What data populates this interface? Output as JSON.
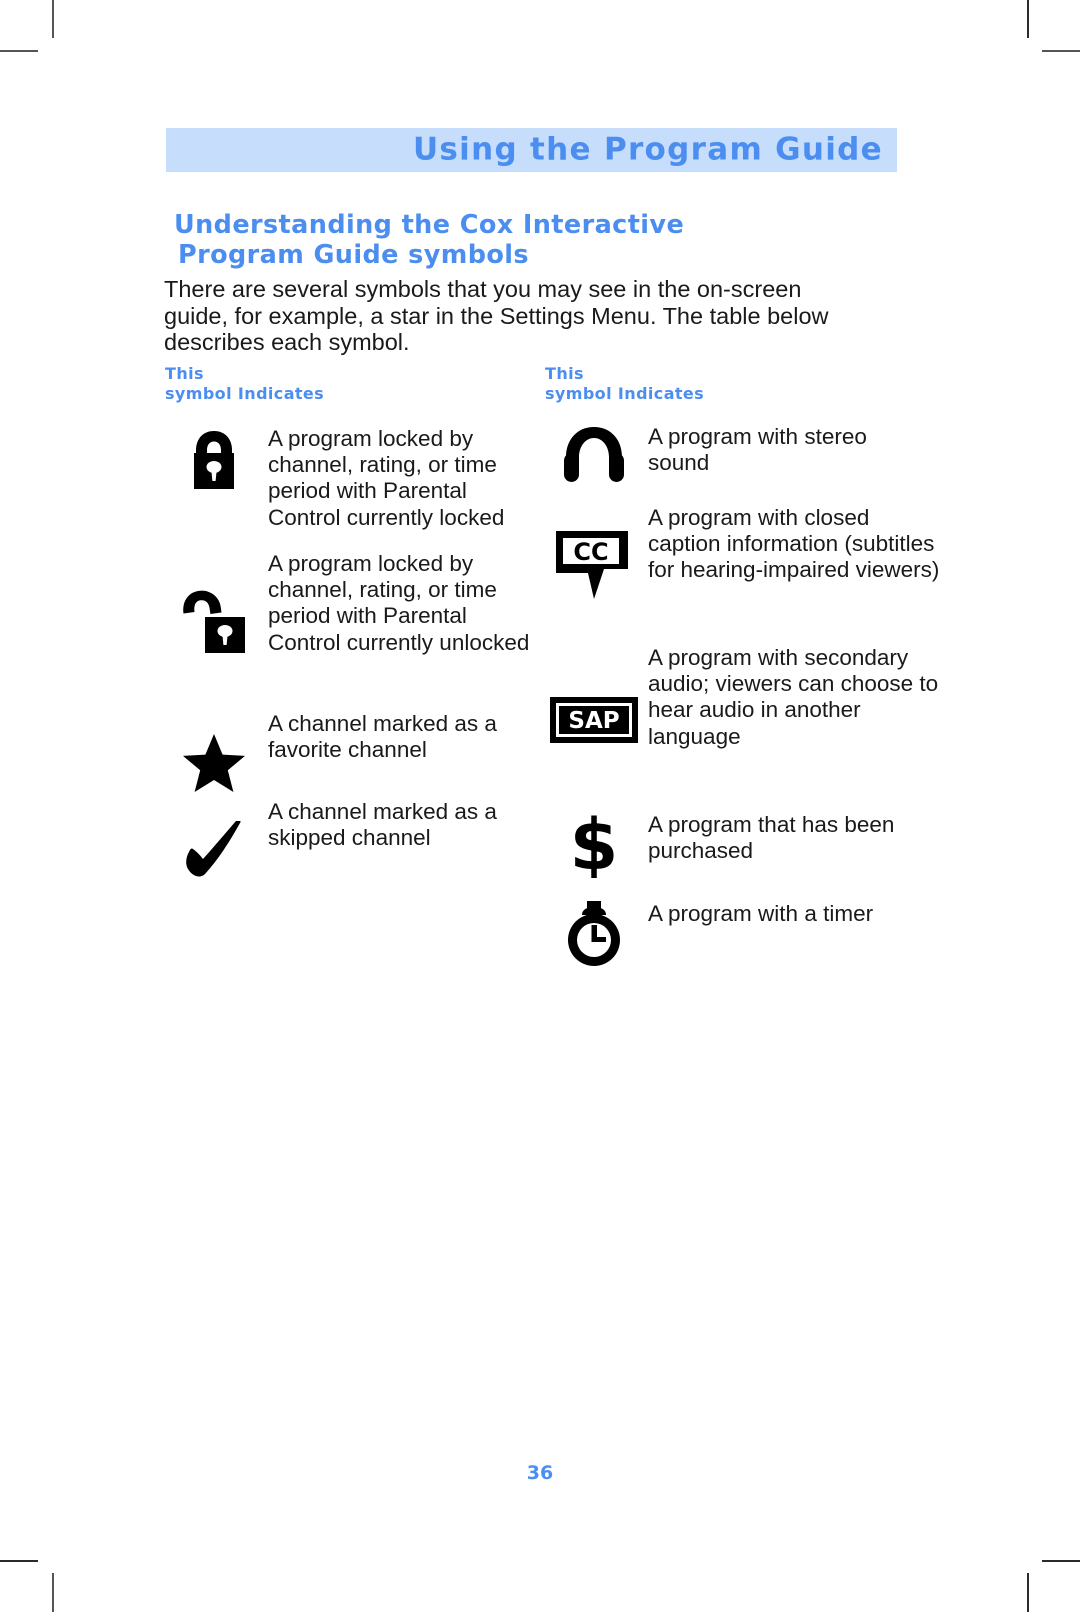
{
  "document": {
    "running_header": "Using the Program Guide",
    "section_heading_line1": "Understanding the Cox Interactive",
    "section_heading_line2": "Program Guide symbols",
    "intro_paragraph": "There are several symbols that you may see in the on-screen guide, for example, a star in the Settings Menu. The table below describes each symbol.",
    "page_number": "36"
  },
  "colors": {
    "accent_blue": "#4c8ef0",
    "banner_background": "#c6ddfb",
    "body_text": "#1a1a1a",
    "symbol_black": "#000000"
  },
  "table": {
    "headers": {
      "left": {
        "line1": "This",
        "line2": "symbol Indicates"
      },
      "right": {
        "line1": "This",
        "line2": "symbol Indicates"
      }
    },
    "left_column": [
      {
        "icon": "padlock-closed-icon",
        "description": "A program locked by channel, rating, or time period with Parental Control currently locked"
      },
      {
        "icon": "padlock-open-icon",
        "description": "A program locked by channel, rating, or time period with Parental Control currently unlocked"
      },
      {
        "icon": "star-icon",
        "description": "A channel marked as a favorite channel"
      },
      {
        "icon": "checkmark-icon",
        "description": "A channel marked as a skipped channel"
      }
    ],
    "right_column": [
      {
        "icon": "headphones-icon",
        "description": "A program with stereo sound"
      },
      {
        "icon": "closed-caption-icon",
        "icon_label": "CC",
        "description": "A program with closed caption information (subtitles for hearing-impaired viewers)"
      },
      {
        "icon": "sap-badge-icon",
        "icon_label": "SAP",
        "description": "A program with secondary audio; viewers can choose to hear audio in another language"
      },
      {
        "icon": "dollar-sign-icon",
        "icon_label": "$",
        "description": "A program that has been purchased"
      },
      {
        "icon": "stopwatch-timer-icon",
        "description": "A program with a timer"
      }
    ]
  }
}
